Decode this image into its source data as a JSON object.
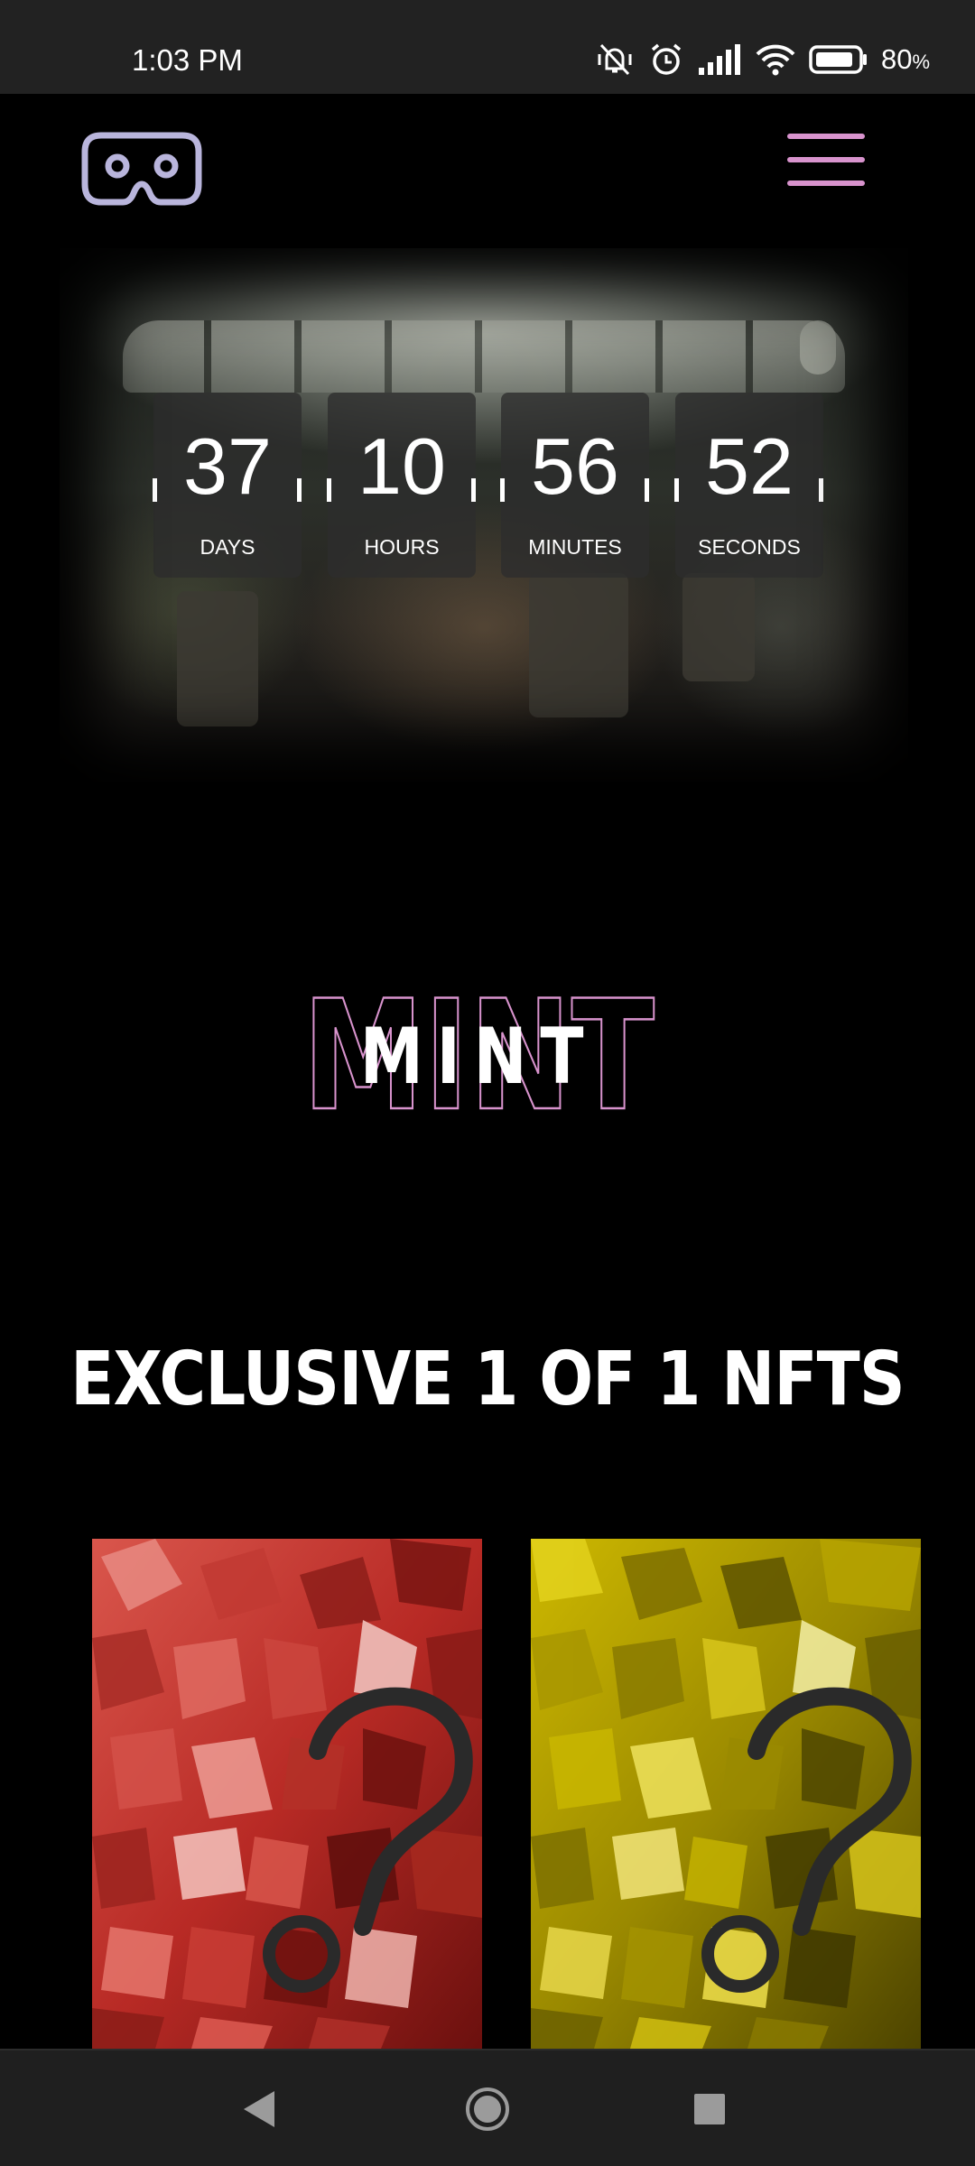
{
  "status_bar": {
    "time": "1:03 PM",
    "battery_text": "80",
    "battery_unit": "%",
    "icons": [
      "mute-vibrate-icon",
      "alarm-icon",
      "signal-icon",
      "wifi-icon",
      "battery-icon"
    ]
  },
  "header": {
    "logo_icon": "vr-headset-icon",
    "menu_icon": "hamburger-menu-icon"
  },
  "countdown": {
    "units": [
      {
        "value": "37",
        "label": "DAYS"
      },
      {
        "value": "10",
        "label": "HOURS"
      },
      {
        "value": "56",
        "label": "MINUTES"
      },
      {
        "value": "52",
        "label": "SECONDS"
      }
    ]
  },
  "mint": {
    "outline_text": "MINT",
    "title": "MINT"
  },
  "nfts": {
    "heading": "EXCLUSIVE 1 OF 1 NFTS",
    "cards": [
      {
        "name": "mystery-nft-red",
        "color": "#c0352c"
      },
      {
        "name": "mystery-nft-yellow",
        "color": "#b8a300"
      }
    ]
  },
  "nav": {
    "back_icon": "back-triangle-icon",
    "home_icon": "home-circle-icon",
    "recents_icon": "recents-square-icon"
  },
  "colors": {
    "accent_pink": "#d893cd",
    "logo_lavender": "#b9b5dc",
    "background": "#000000"
  }
}
